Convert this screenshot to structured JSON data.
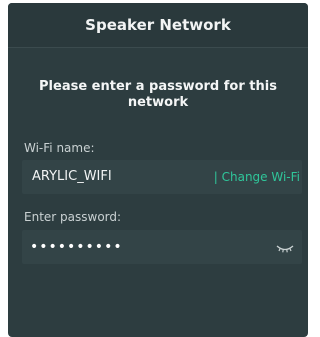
{
  "dialog": {
    "title": "Speaker Network",
    "prompt": "Please enter a password for this network",
    "wifi": {
      "label": "Wi-Fi name:",
      "name": "ARYLIC_WIFI",
      "change_label": "| Change Wi-Fi"
    },
    "password": {
      "label": "Enter password:",
      "value": "••••••••••",
      "visibility_icon": "eye-closed-icon"
    }
  },
  "colors": {
    "background": "#2d3d40",
    "field_background": "#334447",
    "accent": "#2fc69a",
    "text": "#f2f4f4"
  }
}
